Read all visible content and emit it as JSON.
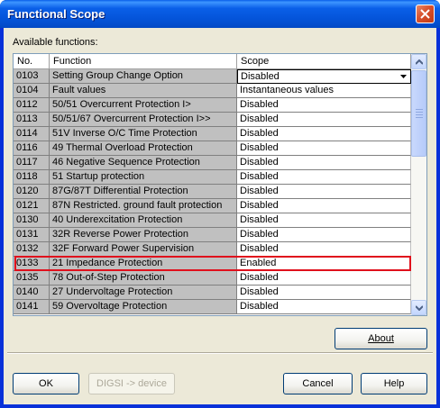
{
  "window": {
    "title": "Functional Scope"
  },
  "available_label": "Available functions:",
  "table": {
    "headers": {
      "no": "No.",
      "function": "Function",
      "scope": "Scope"
    },
    "rows": [
      {
        "no": "0103",
        "function": "Setting Group Change Option",
        "scope": "Disabled"
      },
      {
        "no": "0104",
        "function": "Fault values",
        "scope": "Instantaneous values"
      },
      {
        "no": "0112",
        "function": "50/51 Overcurrent Protection I>",
        "scope": "Disabled"
      },
      {
        "no": "0113",
        "function": "50/51/67 Overcurrent Protection I>>",
        "scope": "Disabled"
      },
      {
        "no": "0114",
        "function": "51V Inverse O/C Time Protection",
        "scope": "Disabled"
      },
      {
        "no": "0116",
        "function": "49 Thermal Overload Protection",
        "scope": "Disabled"
      },
      {
        "no": "0117",
        "function": "46 Negative Sequence  Protection",
        "scope": "Disabled"
      },
      {
        "no": "0118",
        "function": "51 Startup protection",
        "scope": "Disabled"
      },
      {
        "no": "0120",
        "function": "87G/87T Differential Protection",
        "scope": "Disabled"
      },
      {
        "no": "0121",
        "function": "87N Restricted. ground fault protection",
        "scope": "Disabled"
      },
      {
        "no": "0130",
        "function": "40 Underexcitation Protection",
        "scope": "Disabled"
      },
      {
        "no": "0131",
        "function": "32R Reverse Power Protection",
        "scope": "Disabled"
      },
      {
        "no": "0132",
        "function": "32F Forward Power Supervision",
        "scope": "Disabled"
      },
      {
        "no": "0133",
        "function": "21 Impedance Protection",
        "scope": "Enabled"
      },
      {
        "no": "0135",
        "function": "78 Out-of-Step Protection",
        "scope": "Disabled"
      },
      {
        "no": "0140",
        "function": "27 Undervoltage Protection",
        "scope": "Disabled"
      },
      {
        "no": "0141",
        "function": "59 Overvoltage Protection",
        "scope": "Disabled"
      }
    ],
    "highlighted_row_index": 13
  },
  "buttons": {
    "about": "About",
    "ok": "OK",
    "digsi": "DIGSI -> device",
    "cancel": "Cancel",
    "help": "Help"
  },
  "colors": {
    "highlight_border": "#e0101c",
    "title_bar": "#0a5fe8",
    "dialog_bg": "#ece9d8"
  },
  "icons": {
    "close": "close-icon",
    "dropdown": "chevron-down-icon",
    "scroll_up": "scroll-up-icon",
    "scroll_down": "scroll-down-icon"
  }
}
